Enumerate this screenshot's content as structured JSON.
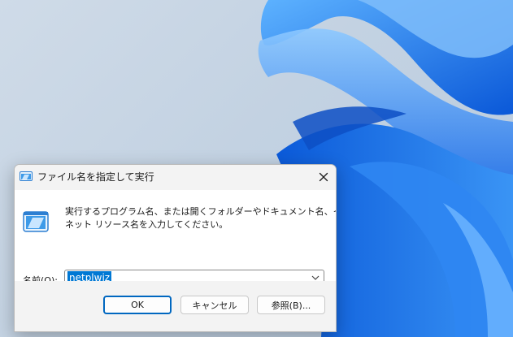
{
  "dialog": {
    "title": "ファイル名を指定して実行",
    "description_line1": "実行するプログラム名、または開くフォルダーやドキュメント名、インター",
    "description_line2": "ネット リソース名を入力してください。",
    "name_label": "名前(O):",
    "input_value": "netplwiz",
    "buttons": {
      "ok": "OK",
      "cancel": "キャンセル",
      "browse": "参照(B)..."
    }
  },
  "icons": {
    "title": "run-icon",
    "body": "run-icon",
    "close": "close-icon",
    "dropdown": "chevron-down-icon"
  },
  "colors": {
    "accent": "#0067c0",
    "selection": "#0078d4",
    "wallpaper_blue": "#1f7bf0"
  }
}
